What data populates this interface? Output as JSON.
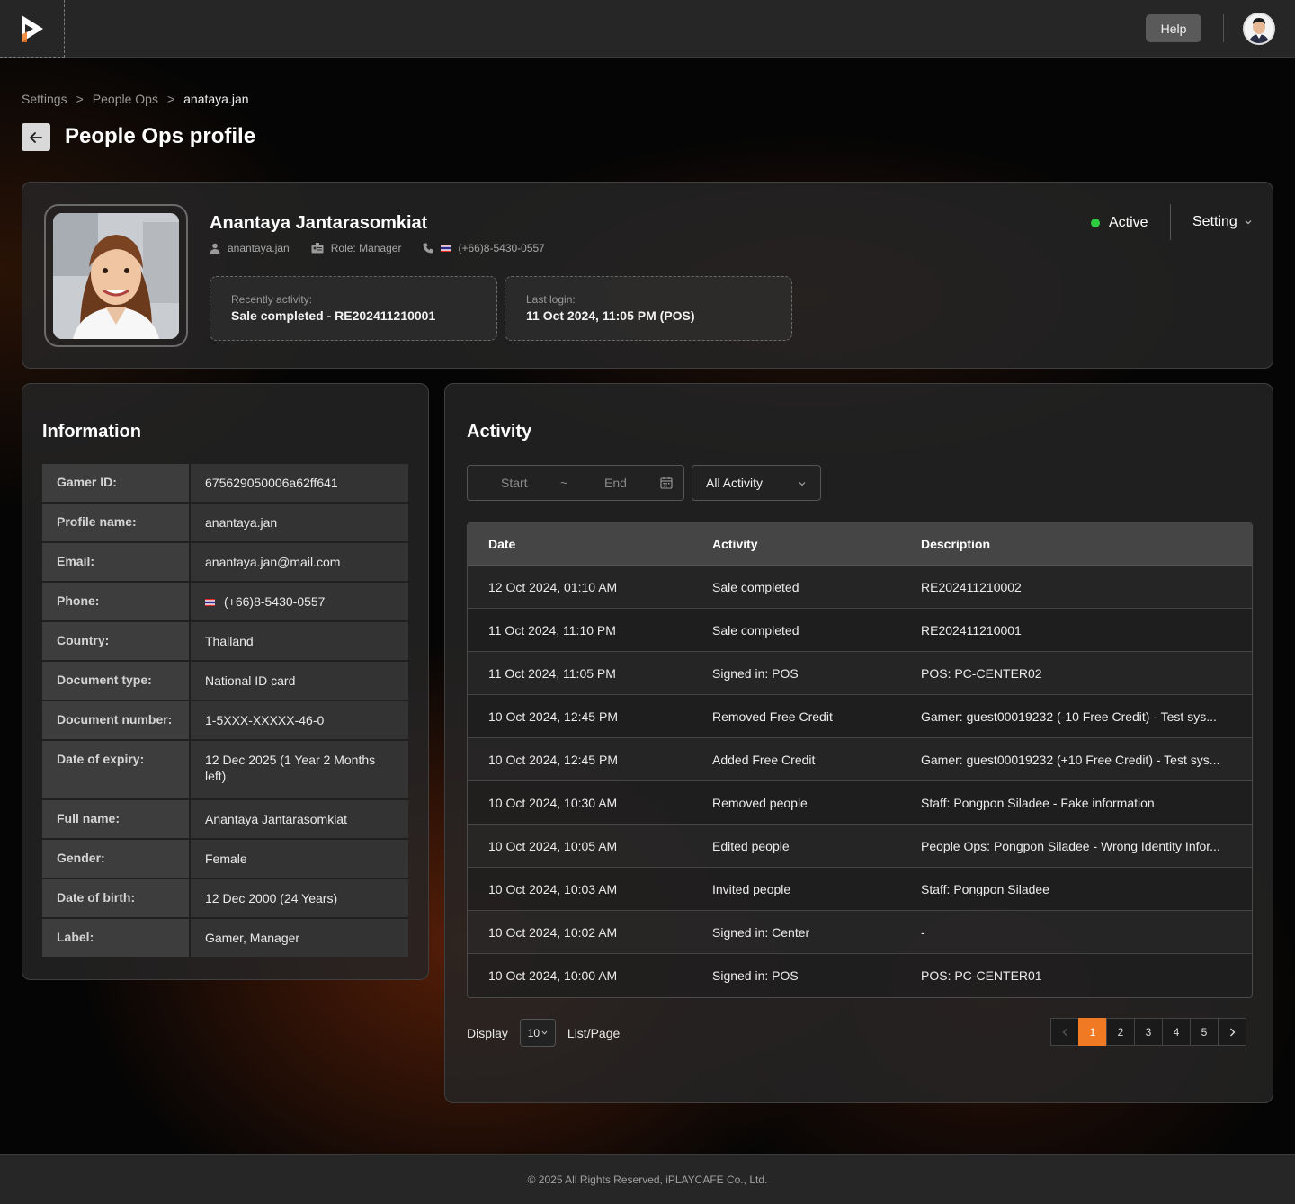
{
  "topbar": {
    "help_label": "Help"
  },
  "breadcrumb": {
    "items": [
      "Settings",
      "People Ops",
      "anataya.jan"
    ],
    "separator": ">"
  },
  "page": {
    "title": "People Ops profile"
  },
  "profile": {
    "name": "Anantaya Jantarasomkiat",
    "username": "anantaya.jan",
    "role": "Role: Manager",
    "phone": "(+66)8-5430-0557",
    "recent_activity_label": "Recently activity:",
    "recent_activity_value": "Sale completed - RE202411210001",
    "last_login_label": "Last login:",
    "last_login_value": "11 Oct 2024, 11:05 PM (POS)",
    "status": "Active",
    "status_color": "#2ecc40",
    "setting_label": "Setting"
  },
  "information": {
    "title": "Information",
    "rows": [
      {
        "key": "Gamer ID:",
        "value": "675629050006a62ff641"
      },
      {
        "key": "Profile name:",
        "value": "anantaya.jan"
      },
      {
        "key": "Email:",
        "value": "anantaya.jan@mail.com"
      },
      {
        "key": "Phone:",
        "value": "(+66)8-5430-0557"
      },
      {
        "key": "Country:",
        "value": "Thailand"
      },
      {
        "key": "Document type:",
        "value": "National ID card"
      },
      {
        "key": "Document number:",
        "value": "1-5XXX-XXXXX-46-0"
      },
      {
        "key": "Date of expiry:",
        "value": "12 Dec 2025 (1 Year 2 Months left)"
      },
      {
        "key": "Full name:",
        "value": "Anantaya Jantarasomkiat"
      },
      {
        "key": "Gender:",
        "value": "Female"
      },
      {
        "key": "Date of birth:",
        "value": "12 Dec 2000  (24 Years)"
      },
      {
        "key": "Label:",
        "value": "Gamer, Manager"
      }
    ]
  },
  "activity": {
    "title": "Activity",
    "date_start_placeholder": "Start",
    "date_sep": "~",
    "date_end_placeholder": "End",
    "filter_value": "All Activity",
    "columns": [
      "Date",
      "Activity",
      "Description"
    ],
    "rows": [
      {
        "date": "12 Oct 2024, 01:10 AM",
        "activity": "Sale completed",
        "description": "RE202411210002"
      },
      {
        "date": "11 Oct 2024, 11:10 PM",
        "activity": "Sale completed",
        "description": "RE202411210001"
      },
      {
        "date": "11 Oct 2024, 11:05 PM",
        "activity": "Signed in: POS",
        "description": "POS: PC-CENTER02"
      },
      {
        "date": "10 Oct 2024, 12:45 PM",
        "activity": "Removed Free Credit",
        "description": "Gamer: guest00019232  (-10 Free Credit) - Test sys..."
      },
      {
        "date": "10 Oct 2024, 12:45 PM",
        "activity": "Added Free Credit",
        "description": "Gamer: guest00019232  (+10 Free Credit) - Test sys..."
      },
      {
        "date": "10 Oct 2024, 10:30 AM",
        "activity": "Removed people",
        "description": "Staff: Pongpon Siladee - Fake information"
      },
      {
        "date": "10 Oct 2024, 10:05 AM",
        "activity": "Edited people",
        "description": "People Ops: Pongpon Siladee -  Wrong Identity Infor..."
      },
      {
        "date": "10 Oct 2024, 10:03 AM",
        "activity": "Invited people",
        "description": "Staff: Pongpon Siladee"
      },
      {
        "date": "10 Oct 2024, 10:02 AM",
        "activity": "Signed in: Center",
        "description": "-"
      },
      {
        "date": "10 Oct 2024, 10:00 AM",
        "activity": "Signed in: POS",
        "description": "POS: PC-CENTER01"
      }
    ],
    "display_label": "Display",
    "page_size": "10",
    "list_page_label": "List/Page",
    "pages": [
      "1",
      "2",
      "3",
      "4",
      "5"
    ],
    "current_page": "1",
    "accent_color": "#f07a24"
  },
  "footer": {
    "text": "© 2025 All Rights Reserved, iPLAYCAFE Co., Ltd."
  }
}
